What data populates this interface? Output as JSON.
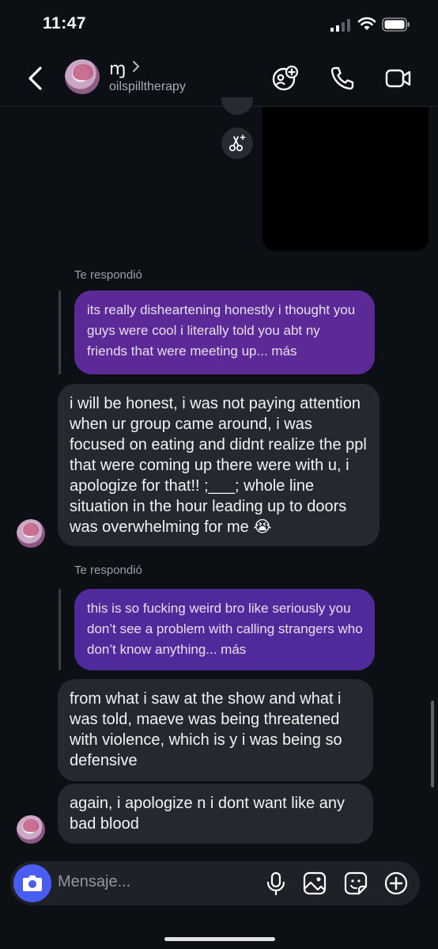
{
  "status": {
    "time": "11:47",
    "icons": [
      "cellular-signal-icon",
      "wifi-icon",
      "battery-icon"
    ]
  },
  "header": {
    "display_name_glyph": "ɱ",
    "username": "oilspilltherapy",
    "icons": [
      "back-arrow-icon",
      "chevron-right-icon",
      "add-people-icon",
      "phone-icon",
      "video-camera-icon"
    ]
  },
  "conversation": {
    "messages": [
      {
        "reply_label": "Te respondió",
        "quoted_text": "its really disheartening honestly i thought you guys were cool i literally told you abt ny friends that were meeting up... más",
        "reply_text": "i will be honest, i was not paying attention when ur group came around, i was focused on eating and didnt realize the ppl that were coming up there were with u, i apologize for that!! ;___; whole line situation in the hour leading up to doors was overwhelming for me 😭"
      },
      {
        "reply_label": "Te respondió",
        "quoted_text": "this is so fucking weird bro like seriously you don’t see a problem with calling strangers who don’t know anything... más",
        "reply_text": "from what i saw at the show and what i was told, maeve was being threatened with violence, which is y i was being so defensive"
      },
      {
        "reply_text": "again, i apologize n i dont want like any bad blood"
      }
    ]
  },
  "composer": {
    "placeholder": "Mensaje...",
    "icons": [
      "camera-icon",
      "microphone-icon",
      "gallery-icon",
      "sticker-icon",
      "add-icon"
    ]
  },
  "colors": {
    "background": "#0c0f14",
    "incoming_bubble": "#25282e",
    "quoted_purple_1": "#5b2a96",
    "quoted_purple_2": "#4f2a9b",
    "camera_blue": "#4a5df2"
  }
}
